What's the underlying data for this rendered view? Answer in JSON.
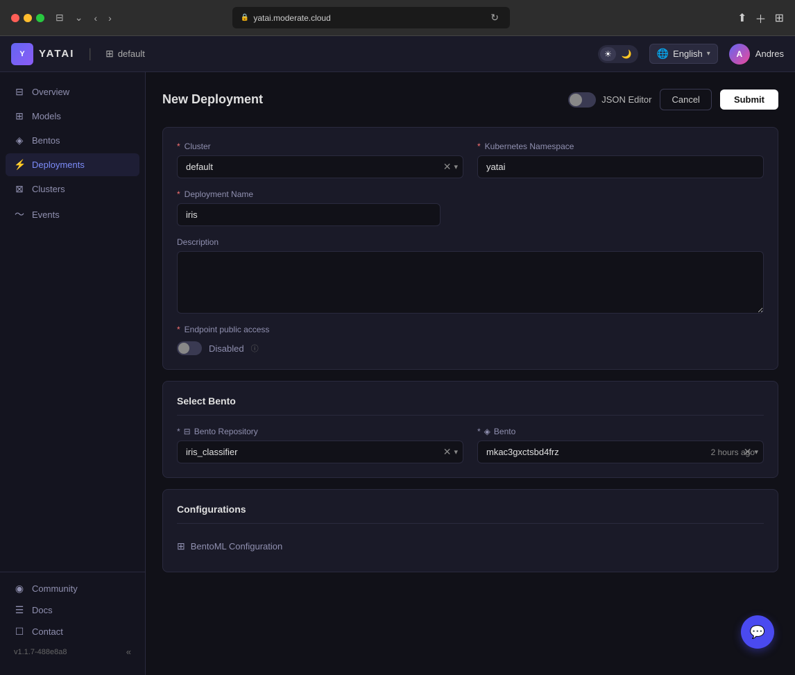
{
  "browser": {
    "url": "yatai.moderate.cloud",
    "favicon": "🔒"
  },
  "app": {
    "logo_text": "YATAI",
    "context_icon": "⊞",
    "context_label": "default"
  },
  "header": {
    "theme_light": "☀",
    "theme_dark": "🌙",
    "globe_icon": "🌐",
    "language": "English",
    "language_chevron": "▾",
    "user_name": "Andres",
    "user_initials": "A"
  },
  "sidebar": {
    "items": [
      {
        "id": "overview",
        "icon": "⊟",
        "label": "Overview",
        "active": false
      },
      {
        "id": "models",
        "icon": "⊞",
        "label": "Models",
        "active": false
      },
      {
        "id": "bentos",
        "icon": "◈",
        "label": "Bentos",
        "active": false
      },
      {
        "id": "deployments",
        "icon": "⚡",
        "label": "Deployments",
        "active": true
      },
      {
        "id": "clusters",
        "icon": "⊠",
        "label": "Clusters",
        "active": false
      },
      {
        "id": "events",
        "icon": "〜",
        "label": "Events",
        "active": false
      }
    ],
    "bottom_items": [
      {
        "id": "community",
        "icon": "◉",
        "label": "Community"
      },
      {
        "id": "docs",
        "icon": "☰",
        "label": "Docs"
      },
      {
        "id": "contact",
        "icon": "☐",
        "label": "Contact"
      }
    ],
    "version": "v1.1.7-488e8a8",
    "collapse_icon": "«"
  },
  "page": {
    "title": "New Deployment",
    "json_editor_label": "JSON Editor",
    "cancel_label": "Cancel",
    "submit_label": "Submit"
  },
  "form": {
    "cluster": {
      "label": "Cluster",
      "required": true,
      "value": "default"
    },
    "kubernetes_namespace": {
      "label": "Kubernetes Namespace",
      "required": true,
      "value": "yatai"
    },
    "deployment_name": {
      "label": "Deployment Name",
      "required": true,
      "value": "iris"
    },
    "description": {
      "label": "Description",
      "placeholder": ""
    },
    "endpoint_access": {
      "label": "Endpoint public access",
      "required": true,
      "status": "Disabled"
    }
  },
  "select_bento": {
    "section_title": "Select Bento",
    "bento_repository": {
      "label": "Bento Repository",
      "required": true,
      "icon": "⊟",
      "value": "iris_classifier"
    },
    "bento": {
      "label": "Bento",
      "required": true,
      "icon": "◈",
      "value": "mkac3gxctsbd4frz",
      "timestamp": "2 hours ago"
    }
  },
  "configurations": {
    "section_title": "Configurations",
    "config_item": {
      "icon": "⊞",
      "label": "BentoML Configuration"
    }
  },
  "chat": {
    "icon": "💬"
  }
}
